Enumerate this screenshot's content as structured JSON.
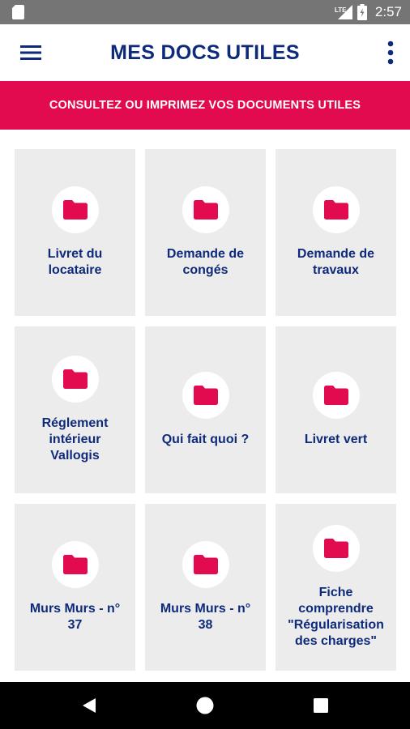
{
  "status_bar": {
    "time": "2:57",
    "network_label": "LTE",
    "icons": [
      "sd-card-icon",
      "signal-icon",
      "battery-icon"
    ]
  },
  "app_bar": {
    "title": "MES DOCS UTILES",
    "icons": [
      "menu-icon",
      "more-vert-icon"
    ]
  },
  "banner": {
    "text": "CONSULTEZ OU IMPRIMEZ VOS DOCUMENTS UTILES"
  },
  "documents": [
    {
      "label": "Livret du\nlocataire",
      "icon": "folder-icon"
    },
    {
      "label": "Demande de\ncongés",
      "icon": "folder-icon"
    },
    {
      "label": "Demande de\ntravaux",
      "icon": "folder-icon"
    },
    {
      "label": "Réglement\nintérieur\nVallogis",
      "icon": "folder-icon"
    },
    {
      "label": "Qui fait quoi ?",
      "icon": "folder-icon"
    },
    {
      "label": "Livret vert",
      "icon": "folder-icon"
    },
    {
      "label": "Murs Murs - n°\n37",
      "icon": "folder-icon"
    },
    {
      "label": "Murs Murs - n°\n38",
      "icon": "folder-icon"
    },
    {
      "label": "Fiche\ncomprendre\n\"Régularisation\ndes charges\"",
      "icon": "folder-icon"
    }
  ],
  "nav_bar": {
    "icons": [
      "back-icon",
      "home-icon",
      "recents-icon"
    ]
  },
  "colors": {
    "brand_navy": "#0e2a7b",
    "brand_pink": "#e30b4f",
    "card_bg": "#ececec",
    "status_bar": "#757575"
  }
}
